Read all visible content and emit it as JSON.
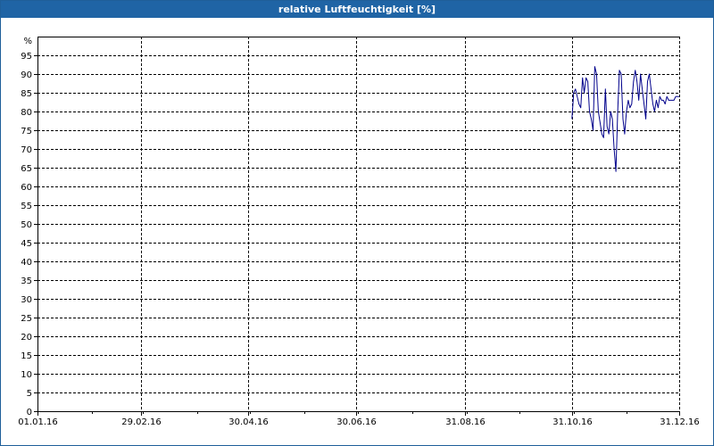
{
  "window": {
    "title": "relative Luftfeuchtigkeit [%]"
  },
  "chart_data": {
    "type": "line",
    "title": "relative Luftfeuchtigkeit [%]",
    "ylabel": "%",
    "xlabel": "",
    "ylim": [
      0,
      100
    ],
    "yticks": [
      0,
      5,
      10,
      15,
      20,
      25,
      30,
      35,
      40,
      45,
      50,
      55,
      60,
      65,
      70,
      75,
      80,
      85,
      90,
      95
    ],
    "xlim": [
      "2016-01-01",
      "2016-12-31"
    ],
    "xticks": [
      {
        "date": "2016-01-01",
        "label": "01.01.16"
      },
      {
        "date": "2016-02-29",
        "label": "29.02.16"
      },
      {
        "date": "2016-04-30",
        "label": "30.04.16"
      },
      {
        "date": "2016-06-30",
        "label": "30.06.16"
      },
      {
        "date": "2016-08-31",
        "label": "31.08.16"
      },
      {
        "date": "2016-10-31",
        "label": "31.10.16"
      },
      {
        "date": "2016-12-31",
        "label": "31.12.16"
      }
    ],
    "grid": true,
    "colors": {
      "line": "#00008b",
      "grid": "#000000"
    },
    "series": [
      {
        "x": [
          "2016-10-31",
          "2016-11-01",
          "2016-11-02",
          "2016-11-03",
          "2016-11-04",
          "2016-11-05",
          "2016-11-06",
          "2016-11-07",
          "2016-11-08",
          "2016-11-09",
          "2016-11-10",
          "2016-11-11",
          "2016-11-12",
          "2016-11-13",
          "2016-11-14",
          "2016-11-15",
          "2016-11-16",
          "2016-11-17",
          "2016-11-18",
          "2016-11-19",
          "2016-11-20",
          "2016-11-21",
          "2016-11-22",
          "2016-11-23",
          "2016-11-24",
          "2016-11-25",
          "2016-11-26",
          "2016-11-27",
          "2016-11-28",
          "2016-11-29",
          "2016-11-30",
          "2016-12-01",
          "2016-12-02",
          "2016-12-03",
          "2016-12-04",
          "2016-12-05",
          "2016-12-06",
          "2016-12-07",
          "2016-12-08",
          "2016-12-09",
          "2016-12-10",
          "2016-12-11",
          "2016-12-12",
          "2016-12-13",
          "2016-12-14",
          "2016-12-15",
          "2016-12-16",
          "2016-12-17",
          "2016-12-18",
          "2016-12-19",
          "2016-12-20",
          "2016-12-21",
          "2016-12-22",
          "2016-12-23",
          "2016-12-24",
          "2016-12-25",
          "2016-12-26",
          "2016-12-27",
          "2016-12-28",
          "2016-12-29",
          "2016-12-30",
          "2016-12-31"
        ],
        "y": [
          78,
          85,
          86,
          84,
          82,
          81,
          89,
          85,
          89,
          88,
          80,
          78,
          75,
          92,
          90,
          80,
          77,
          74,
          73,
          86,
          76,
          74,
          80,
          78,
          70,
          64,
          80,
          91,
          90,
          78,
          74,
          80,
          83,
          81,
          82,
          88,
          91,
          88,
          83,
          90,
          86,
          82,
          78,
          88,
          90,
          86,
          82,
          80,
          83,
          81,
          84,
          83,
          83,
          82,
          84,
          83,
          83,
          83,
          83,
          84,
          84,
          84
        ]
      }
    ]
  }
}
